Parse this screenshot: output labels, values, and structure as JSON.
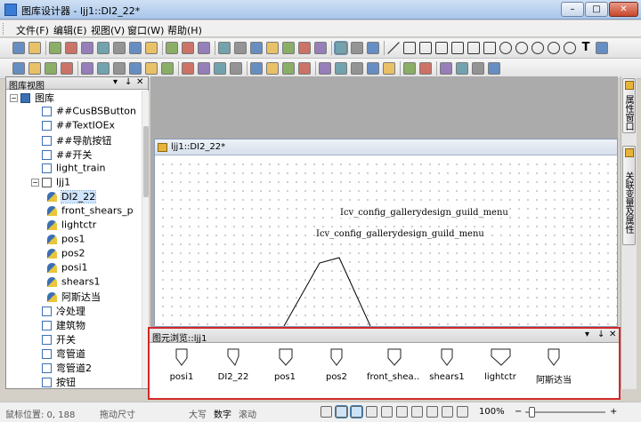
{
  "window": {
    "title": "图库设计器 - ljj1::DI2_22*",
    "min": "–",
    "max": "□",
    "close": "✕"
  },
  "menu": [
    "文件(F)",
    "编辑(E)",
    "视图(V)",
    "窗口(W)",
    "帮助(H)"
  ],
  "toolbar_row1": [
    "new-icon",
    "open-icon",
    "save-as-icon",
    "save-icon",
    "copy-icon",
    "paste-icon",
    "cut-icon",
    "delete-icon",
    "print-icon",
    "help-icon",
    "star-icon",
    "palette-icon",
    "zoom-icon",
    "zoom-fit-icon",
    "pan-icon",
    "zoom-in-icon",
    "zoom-out-icon",
    "fit-page-icon",
    "actual-size-icon",
    "select-icon",
    "select-area-icon",
    "rotate-icon",
    "line-icon",
    "polyline-icon",
    "polygon-icon",
    "rectangle-icon",
    "rounded-rect-icon",
    "curve-icon",
    "bezier-icon",
    "circle-icon",
    "ellipse-icon",
    "arc-icon",
    "pie-icon",
    "chord-icon",
    "text-icon",
    "image-icon"
  ],
  "toolbar_row2": [
    "rotate-left-icon",
    "rotate-right-icon",
    "flip-h-icon",
    "flip-v-icon",
    "align-left-icon",
    "align-center-icon",
    "align-right-icon",
    "align-top-icon",
    "align-middle-icon",
    "align-bottom-icon",
    "bring-front-icon",
    "send-back-icon",
    "move-up-icon",
    "move-down-icon",
    "group-icon",
    "ungroup-icon",
    "same-width-icon",
    "same-height-icon",
    "same-size-icon",
    "space-h-icon",
    "space-v-icon",
    "center-h-icon",
    "center-v-icon",
    "undo-icon",
    "redo-icon",
    "properties-icon",
    "grid-icon",
    "layer-icon",
    "pattern-icon"
  ],
  "tree_panel": {
    "title": "图库视图",
    "ctl_dropdown": "▾",
    "ctl_pin": "↓",
    "ctl_close": "✕",
    "items": [
      {
        "label": "图库",
        "level": 0,
        "icon": "folder",
        "expander": "−"
      },
      {
        "label": "##CusBSButton",
        "level": 1,
        "icon": "gallery"
      },
      {
        "label": "##TextIOEx",
        "level": 1,
        "icon": "gallery"
      },
      {
        "label": "##导航按钮",
        "level": 1,
        "icon": "gallery"
      },
      {
        "label": "##开关",
        "level": 1,
        "icon": "gallery"
      },
      {
        "label": "light_train",
        "level": 1,
        "icon": "gallery"
      },
      {
        "label": "ljj1",
        "level": 1,
        "icon": "group",
        "expander": "−"
      },
      {
        "label": "DI2_22",
        "level": 2,
        "icon": "shape",
        "selected": true
      },
      {
        "label": "front_shears_p",
        "level": 2,
        "icon": "shape"
      },
      {
        "label": "lightctr",
        "level": 2,
        "icon": "shape"
      },
      {
        "label": "pos1",
        "level": 2,
        "icon": "shape"
      },
      {
        "label": "pos2",
        "level": 2,
        "icon": "shape"
      },
      {
        "label": "posi1",
        "level": 2,
        "icon": "shape"
      },
      {
        "label": "shears1",
        "level": 2,
        "icon": "shape"
      },
      {
        "label": "阿斯达当",
        "level": 2,
        "icon": "shape"
      },
      {
        "label": "冷处理",
        "level": 1,
        "icon": "gallery"
      },
      {
        "label": "建筑物",
        "level": 1,
        "icon": "gallery"
      },
      {
        "label": "开关",
        "level": 1,
        "icon": "gallery"
      },
      {
        "label": "弯管道",
        "level": 1,
        "icon": "gallery"
      },
      {
        "label": "弯管道2",
        "level": 1,
        "icon": "gallery"
      },
      {
        "label": "按钮",
        "level": 1,
        "icon": "gallery"
      }
    ]
  },
  "document": {
    "title": "ljj1::DI2_22*",
    "text1": "Icv_config_gallerydesign_guild_menu",
    "text2": "Icv_config_gallerydesign_guild_menu"
  },
  "right_tabs": [
    "属性窗口",
    "关联变量及属性"
  ],
  "browse_panel": {
    "title": "图元浏览::ljj1",
    "ctl_dropdown": "▾",
    "ctl_pin": "↓",
    "ctl_close": "✕",
    "items": [
      "posi1",
      "DI2_22",
      "pos1",
      "pos2",
      "front_shea…",
      "shears1",
      "lightctr",
      "阿斯达当"
    ]
  },
  "status": {
    "position": "鼠标位置: 0, 188",
    "drag": "拖动尺寸",
    "caps": "大写",
    "num": "数字",
    "scroll": "滚动",
    "zoom": "100%",
    "zoom_minus": "−",
    "zoom_plus": "+"
  },
  "colors": {
    "accent": "#3b6fb5",
    "highlight_border": "#d22828",
    "workspace": "#ababab"
  }
}
